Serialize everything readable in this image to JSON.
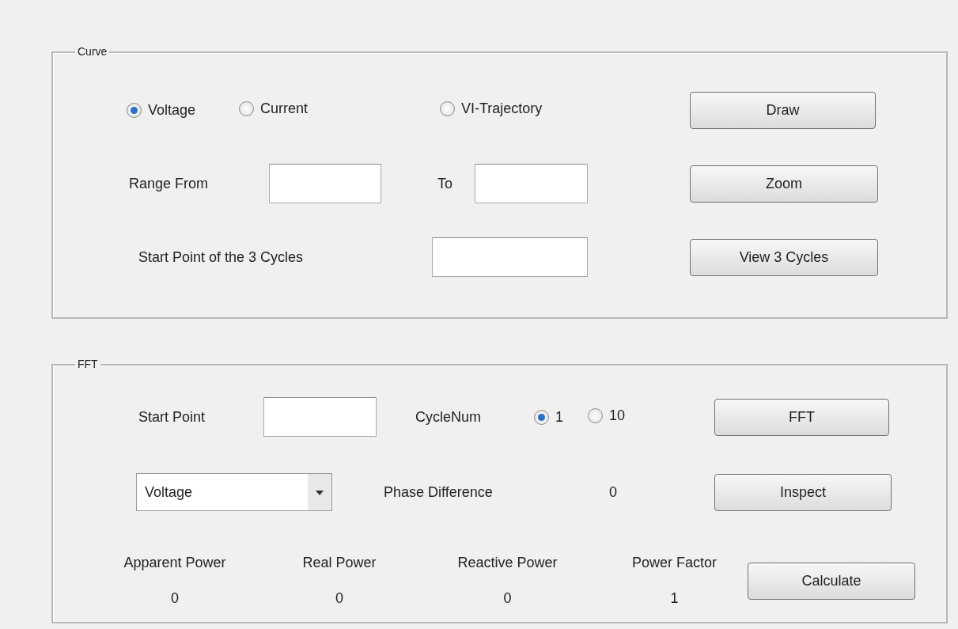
{
  "curve_panel": {
    "title": "Curve",
    "curve_types": [
      {
        "label": "Voltage",
        "selected": true
      },
      {
        "label": "Current",
        "selected": false
      },
      {
        "label": "VI-Trajectory",
        "selected": false
      }
    ],
    "draw_button": "Draw",
    "range_from_label": "Range From",
    "to_label": "To",
    "zoom_button": "Zoom",
    "start_point_label": "Start Point of the 3 Cycles",
    "view_button": "View 3 Cycles"
  },
  "fft_panel": {
    "title": "FFT",
    "start_point_label": "Start Point",
    "cycle_num_label": "CycleNum",
    "cycle_options": [
      {
        "label": "1",
        "selected": true
      },
      {
        "label": "10",
        "selected": false
      }
    ],
    "fft_button": "FFT",
    "signal_select": {
      "value": "Voltage"
    },
    "phase_difference_label": "Phase Difference",
    "phase_difference_value": "0",
    "inspect_button": "Inspect",
    "metrics": [
      {
        "label": "Apparent Power",
        "value": "0"
      },
      {
        "label": "Real Power",
        "value": "0"
      },
      {
        "label": "Reactive Power",
        "value": "0"
      },
      {
        "label": "Power Factor",
        "value": "1"
      }
    ],
    "calculate_button": "Calculate"
  }
}
